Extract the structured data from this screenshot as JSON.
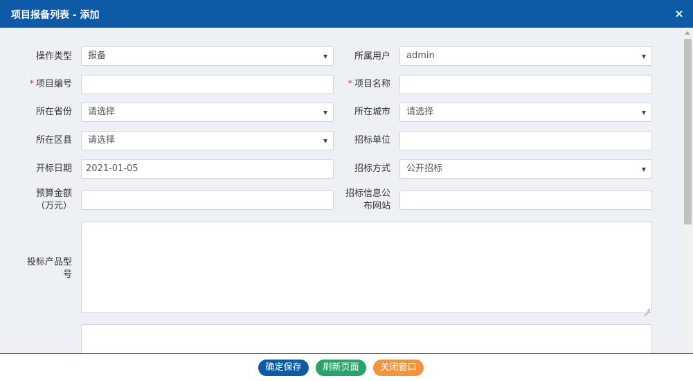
{
  "dialog": {
    "title": "项目报备列表 - 添加",
    "close_icon": "×"
  },
  "form": {
    "operation_type": {
      "label": "操作类型",
      "value": "报备"
    },
    "owner_user": {
      "label": "所属用户",
      "value": "admin"
    },
    "project_code": {
      "required_mark": "*",
      "label": "项目编号",
      "value": ""
    },
    "project_name": {
      "required_mark": "*",
      "label": "项目名称",
      "value": ""
    },
    "province": {
      "label": "所在省份",
      "value": "请选择"
    },
    "city": {
      "label": "所在城市",
      "value": "请选择"
    },
    "district": {
      "label": "所在区县",
      "value": "请选择"
    },
    "tender_unit": {
      "label": "招标单位",
      "value": ""
    },
    "bid_open_date": {
      "label": "开标日期",
      "value": "2021-01-05"
    },
    "tender_method": {
      "label": "招标方式",
      "value": "公开招标"
    },
    "budget": {
      "label_line1": "预算金额",
      "label_line2": "（万元）",
      "value": ""
    },
    "info_site": {
      "label_line1": "招标信息公",
      "label_line2": "布网站",
      "value": ""
    },
    "product_model": {
      "label_line1": "投标产品型",
      "label_line2": "号",
      "value": ""
    }
  },
  "footer": {
    "save_label": "确定保存",
    "refresh_label": "刷新页面",
    "close_label": "关闭窗口"
  },
  "colors": {
    "header": "#0d5aa7",
    "save": "#0d5aa7",
    "refresh": "#2aa36b",
    "close": "#f0953e",
    "required": "#e53935"
  }
}
